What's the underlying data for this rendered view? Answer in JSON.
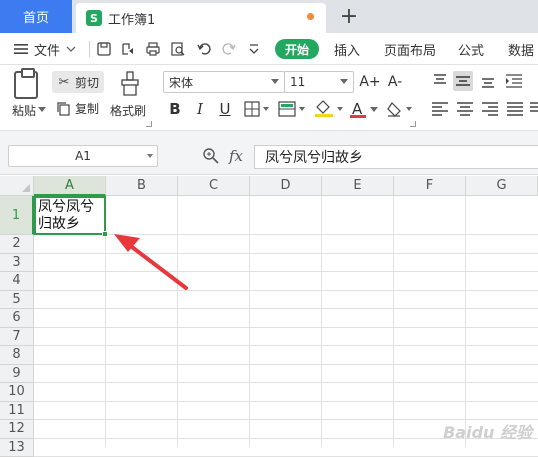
{
  "tabs": {
    "home": "首页",
    "doc_title": "工作簿1",
    "doc_icon_letter": "S",
    "add": "+"
  },
  "menu": {
    "file": "文件",
    "start": "开始",
    "insert": "插入",
    "page_layout": "页面布局",
    "formula": "公式",
    "data": "数据"
  },
  "ribbon": {
    "paste": "粘贴",
    "cut": "剪切",
    "copy": "复制",
    "format_painter": "格式刷",
    "font_name": "宋体",
    "font_size": "11",
    "font_grow": "A+",
    "font_shrink": "A-",
    "bold": "B",
    "italic": "I",
    "underline": "U",
    "font_color_letter": "A"
  },
  "formula_bar": {
    "name_box": "A1",
    "fx": "fx",
    "value": "凤兮凤兮归故乡"
  },
  "sheet": {
    "columns": [
      "A",
      "B",
      "C",
      "D",
      "E",
      "F",
      "G"
    ],
    "rows": [
      "1",
      "2",
      "3",
      "4",
      "5",
      "6",
      "7",
      "8",
      "9",
      "10",
      "11",
      "12",
      "13"
    ],
    "active_cell_text": "凤兮凤兮\n归故乡"
  },
  "watermark": "Baidu 经验",
  "colors": {
    "accent_green": "#22a861",
    "home_tab_blue": "#3d7bf0",
    "selection_green": "#2f9a4a",
    "arrow_red": "#e8383d"
  }
}
